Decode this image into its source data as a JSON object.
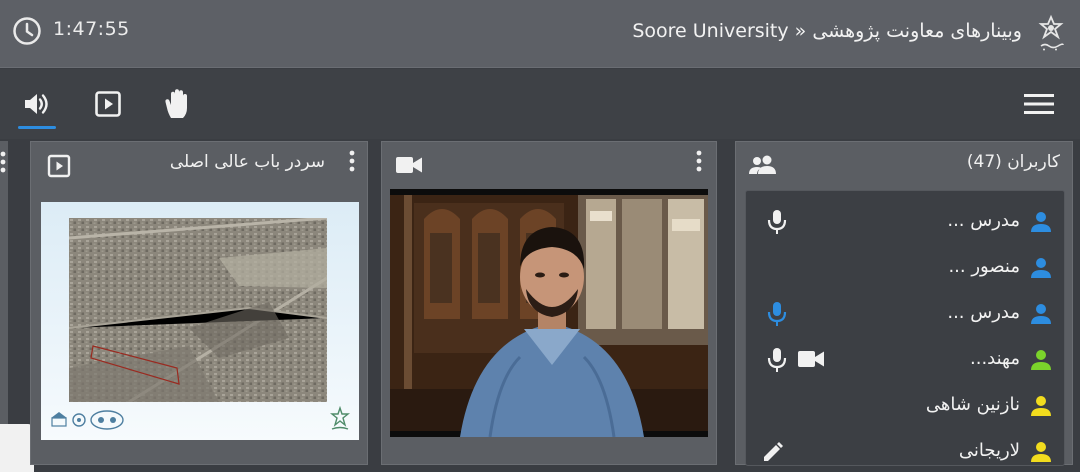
{
  "header": {
    "time": "1:47:55",
    "title": "وبینارهای معاونت پژوهشی « Soore University",
    "icons": {
      "clock": "clock-icon",
      "logo": "university-logo"
    }
  },
  "toolbar": {
    "buttons": [
      {
        "name": "audio",
        "icon": "speaker-icon",
        "active": true
      },
      {
        "name": "presentation",
        "icon": "play-box-icon",
        "active": false
      },
      {
        "name": "raise-hand",
        "icon": "hand-icon",
        "active": false
      }
    ],
    "menu_icon": "hamburger-menu-icon"
  },
  "users_panel": {
    "title": "کاربران (47)",
    "users": [
      {
        "name": "مدرس ...",
        "icon_color": "#2d8de0",
        "mic": "muted-white"
      },
      {
        "name": "منصور ...",
        "icon_color": "#2d8de0",
        "mic": "none"
      },
      {
        "name": "مدرس ...",
        "icon_color": "#2d8de0",
        "mic": "active-blue"
      },
      {
        "name": "مهند...",
        "icon_color": "#7bd32b",
        "mic": "white",
        "camera": true
      },
      {
        "name": "نازنین شاهی",
        "icon_color": "#f2dc1e",
        "mic": "none"
      },
      {
        "name": "لاریجانی",
        "icon_color": "#f2dc1e",
        "mic": "none"
      }
    ]
  },
  "presentation_panel": {
    "title": "سردر باب عالی اصلی"
  },
  "colors": {
    "accent": "#2d8de0",
    "topbar": "#5d6066",
    "panel": "#5b5e63",
    "list_bg": "#3c3f44"
  }
}
